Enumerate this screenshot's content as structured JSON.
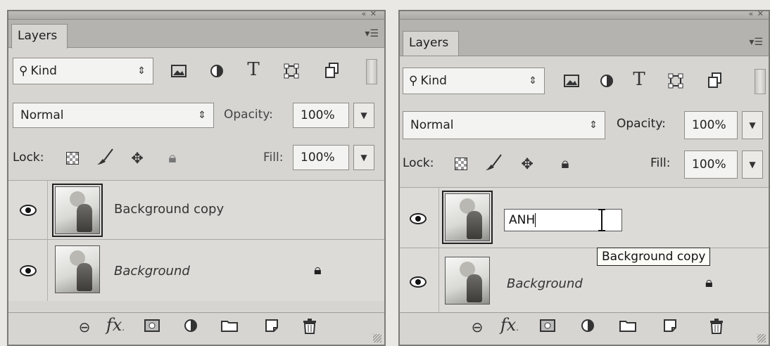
{
  "panels": [
    {
      "tab_label": "Layers",
      "window_controls": "« ✕",
      "menu_icon": "panel-menu-icon",
      "filter": {
        "kind_label": "Kind",
        "kind_icon": "search-icon",
        "icons": [
          "image-filter-icon",
          "adjustment-filter-icon",
          "type-filter-icon",
          "shape-filter-icon",
          "smart-object-filter-icon"
        ]
      },
      "blend_mode": "Normal",
      "opacity_label": "Opacity:",
      "opacity_value": "100%",
      "lock_label": "Lock:",
      "fill_label": "Fill:",
      "fill_value": "100%",
      "layers": [
        {
          "name": "Background copy",
          "visible": true,
          "locked": false
        },
        {
          "name": "Background",
          "visible": true,
          "locked": true
        }
      ],
      "footer_icons": [
        "link-layers-icon",
        "fx-icon",
        "add-mask-icon",
        "adjustment-layer-icon",
        "group-folder-icon",
        "new-layer-icon",
        "trash-icon"
      ],
      "fx_label": "fx"
    },
    {
      "tab_label": "Layers",
      "window_controls": "« ✕",
      "menu_icon": "panel-menu-icon",
      "filter": {
        "kind_label": "Kind",
        "kind_icon": "search-icon",
        "icons": [
          "image-filter-icon",
          "adjustment-filter-icon",
          "type-filter-icon",
          "shape-filter-icon",
          "smart-object-filter-icon"
        ]
      },
      "blend_mode": "Normal",
      "opacity_label": "Opacity:",
      "opacity_value": "100%",
      "lock_label": "Lock:",
      "fill_label": "Fill:",
      "fill_value": "100%",
      "layers": [
        {
          "name": "ANH",
          "visible": true,
          "locked": false,
          "editing": true
        },
        {
          "name": "Background",
          "visible": true,
          "locked": true
        }
      ],
      "tooltip": "Background copy",
      "footer_icons": [
        "link-layers-icon",
        "fx-icon",
        "add-mask-icon",
        "adjustment-layer-icon",
        "group-folder-icon",
        "new-layer-icon",
        "trash-icon"
      ],
      "fx_label": "fx"
    }
  ]
}
